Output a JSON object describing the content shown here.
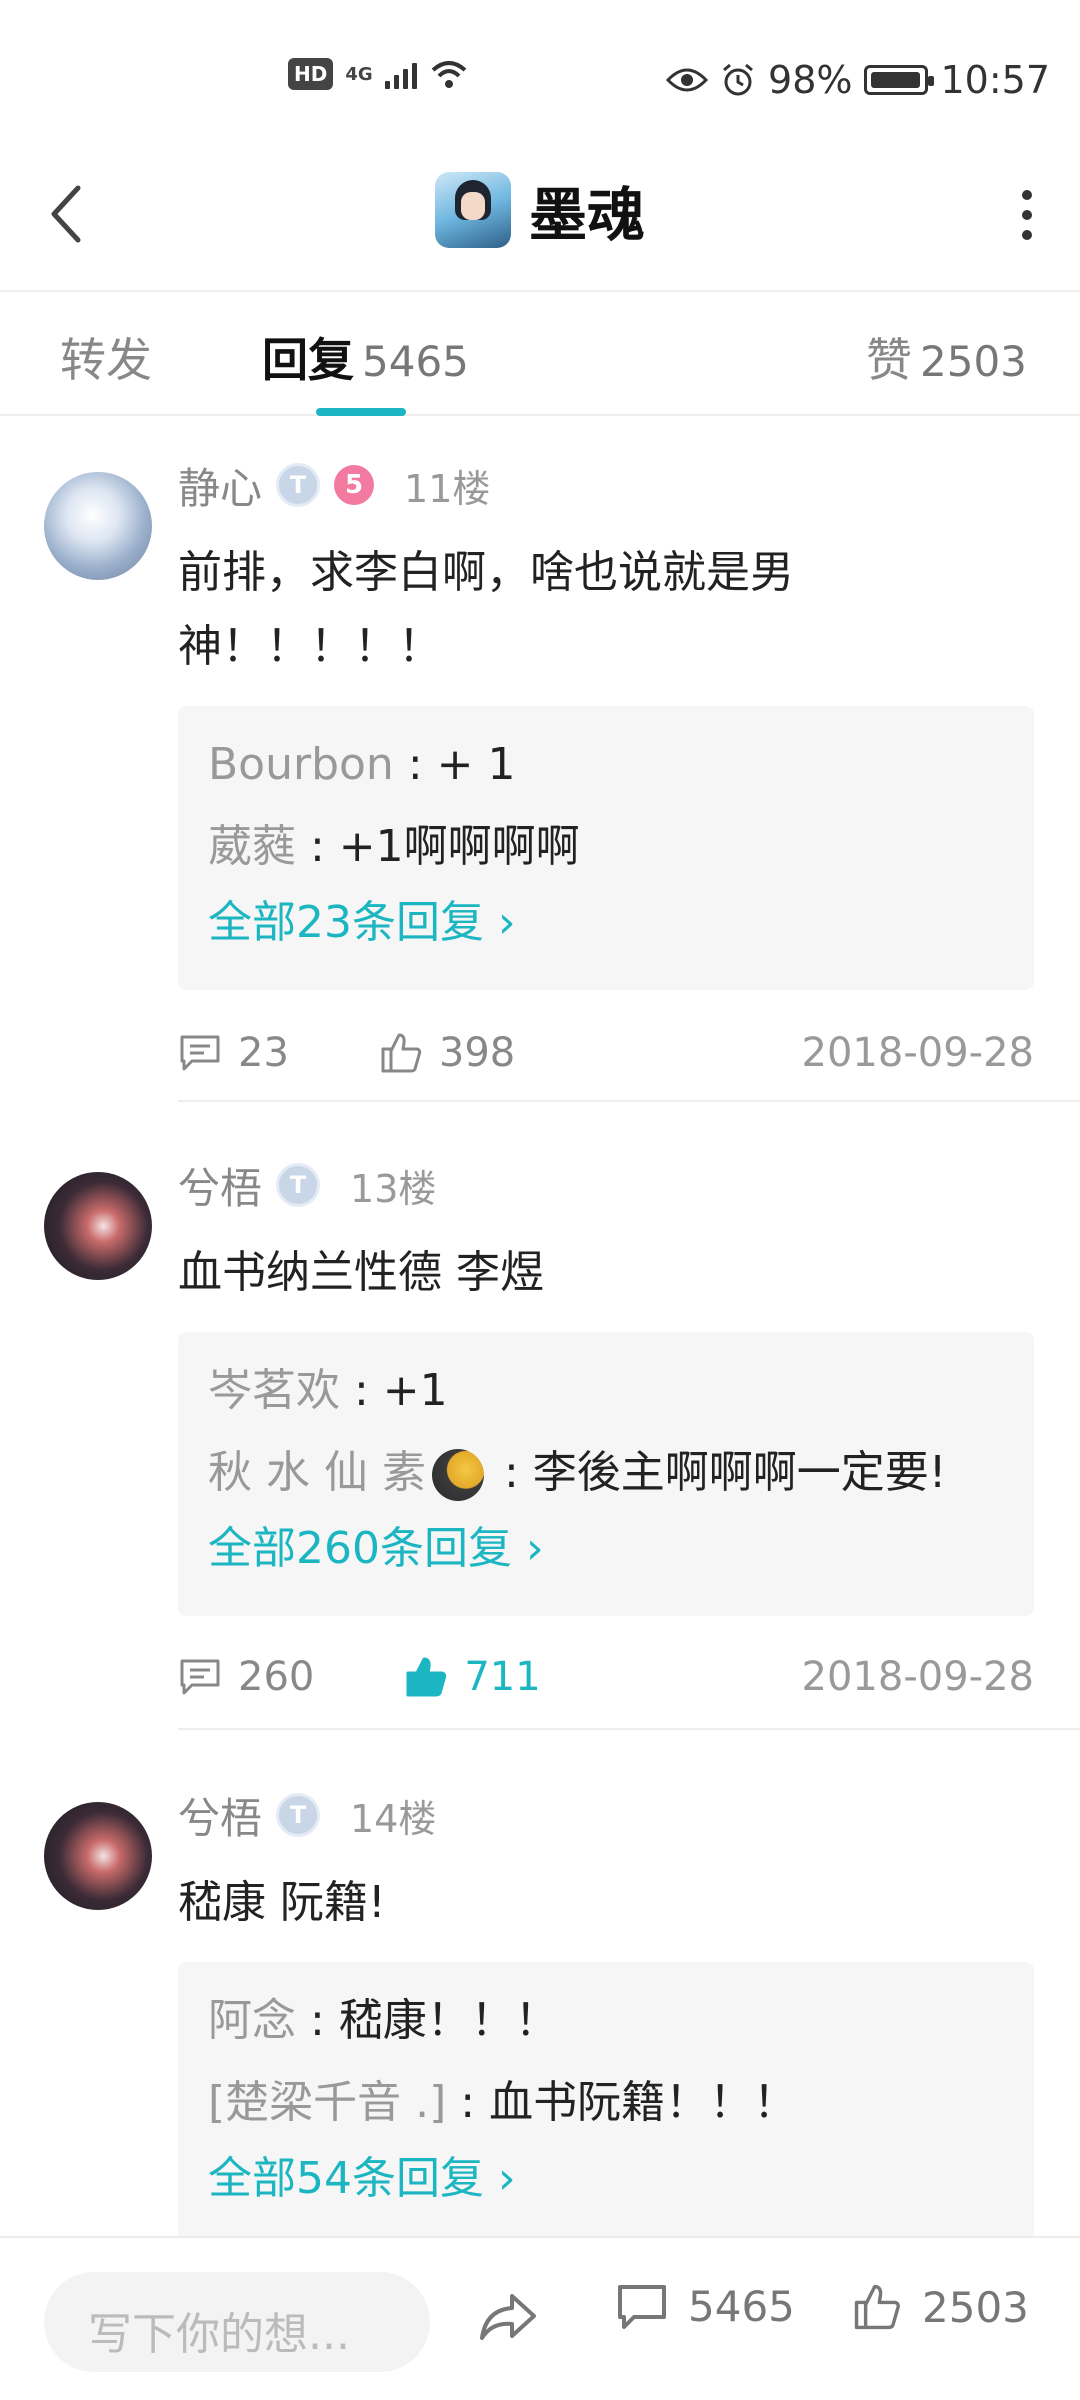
{
  "status_bar": {
    "hd": "HD",
    "network": "4G",
    "battery_percent": "98%",
    "battery_level": 0.98,
    "time": "10:57"
  },
  "header": {
    "title": "墨魂"
  },
  "tabs": [
    {
      "label": "转发",
      "count": ""
    },
    {
      "label": "回复",
      "count": "5465"
    },
    {
      "label": "赞",
      "count": "2503"
    }
  ],
  "active_tab": "回复",
  "accent_color": "#1bb6c1",
  "posts": [
    {
      "author": "静心",
      "badge": "T",
      "level": "5",
      "floor": "11楼",
      "content": "前排，求李白啊，啥也说就是男神！！！！！",
      "replies": [
        {
          "name": "Bourbon",
          "text": "+ 1"
        },
        {
          "name": "葳蕤",
          "text": "+1啊啊啊啊"
        }
      ],
      "all_replies": "全部23条回复",
      "comments": "23",
      "likes": "398",
      "liked": false,
      "date": "2018-09-28"
    },
    {
      "author": "兮梧",
      "badge": "T",
      "floor": "13楼",
      "content": "血书纳兰性德 李煜",
      "replies": [
        {
          "name": "岑茗欢",
          "text": "+1"
        },
        {
          "name": "秋 水 仙 素",
          "text": "李後主啊啊啊一定要!"
        }
      ],
      "all_replies": "全部260条回复",
      "comments": "260",
      "likes": "711",
      "liked": true,
      "date": "2018-09-28"
    },
    {
      "author": "兮梧",
      "badge": "T",
      "floor": "14楼",
      "content": "嵇康 阮籍!",
      "replies": [
        {
          "name": "阿念",
          "text": "嵇康！！！"
        },
        {
          "name": "[楚梁千音 .]",
          "text": "血书阮籍！！！"
        }
      ],
      "all_replies": "全部54条回复"
    }
  ],
  "bottom_bar": {
    "input_placeholder": "写下你的想...",
    "comments": "5465",
    "likes": "2503"
  }
}
